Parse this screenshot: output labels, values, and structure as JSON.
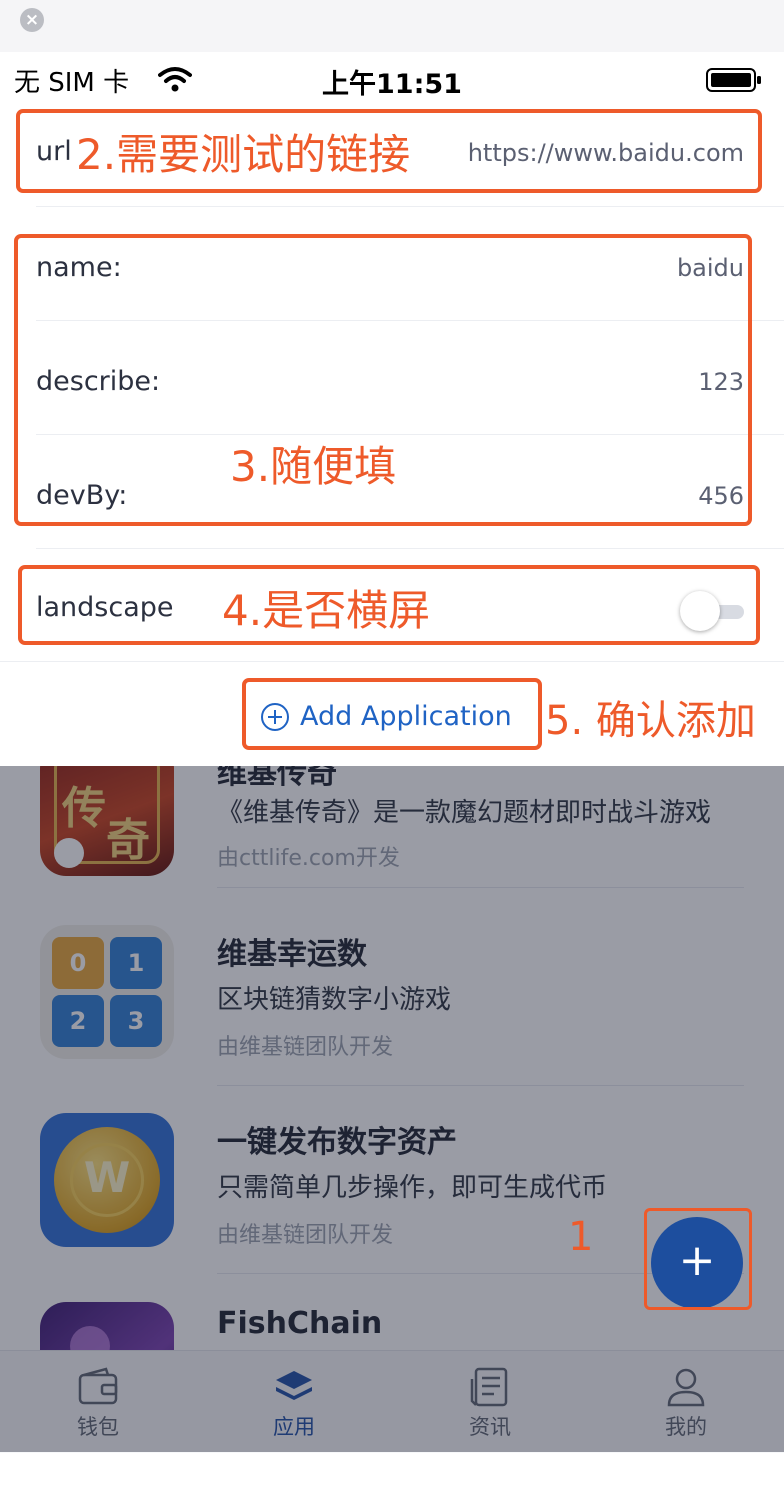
{
  "sheet": {
    "close_label": "×",
    "status": {
      "carrier": "无 SIM 卡",
      "time": "上午11:51"
    },
    "url": {
      "label": "url",
      "value": "https://www.baidu.com"
    },
    "fields": [
      {
        "label": "name:",
        "value": "baidu"
      },
      {
        "label": "describe:",
        "value": "123"
      },
      {
        "label": "devBy:",
        "value": "456"
      }
    ],
    "landscape": {
      "label": "landscape",
      "on": false
    },
    "add_button": "Add Application"
  },
  "annotations": {
    "step1": "1",
    "step2": "2.需要测试的链接",
    "step3": "3.随便填",
    "step4": "4.是否横屏",
    "step5": "5. 确认添加",
    "color": "#ee5a2a"
  },
  "apps": [
    {
      "title": "维基传奇",
      "desc": "《维基传奇》是一款魔幻题材即时战斗游戏",
      "dev": "由cttlife.com开发"
    },
    {
      "title": "维基幸运数",
      "desc": "区块链猜数字小游戏",
      "dev": "由维基链团队开发"
    },
    {
      "title": "一键发布数字资产",
      "desc": "只需简单几步操作，即可生成代币",
      "dev": "由维基链团队开发"
    },
    {
      "title": "FishChain",
      "desc": "",
      "dev": ""
    }
  ],
  "tabs": [
    {
      "label": "钱包",
      "icon": "wallet-icon"
    },
    {
      "label": "应用",
      "icon": "layers-icon",
      "active": true
    },
    {
      "label": "资讯",
      "icon": "news-icon"
    },
    {
      "label": "我的",
      "icon": "profile-icon"
    }
  ],
  "fab_label": "+",
  "lucky_digits": [
    "0",
    "1",
    "2",
    "3"
  ],
  "coin_letter": "W",
  "legend_icon_text": [
    "传",
    "奇"
  ],
  "colors": {
    "accent": "#1d4e9e",
    "link": "#1f63c4",
    "annotation": "#ee5a2a"
  }
}
